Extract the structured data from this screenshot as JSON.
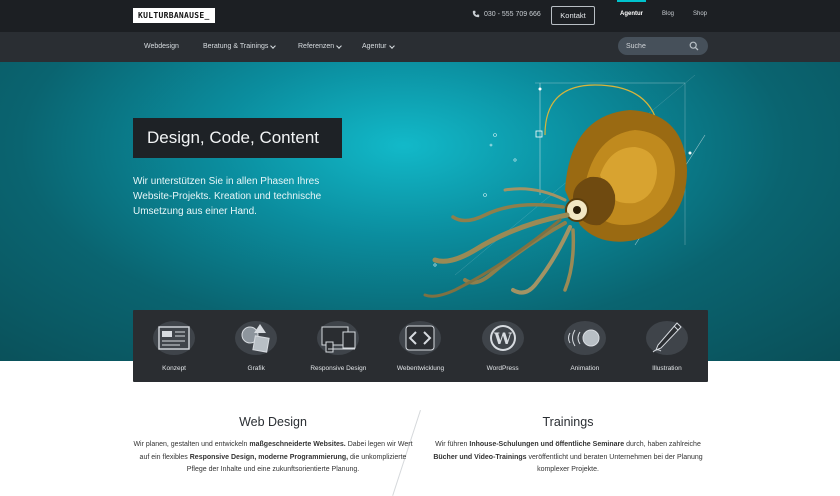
{
  "header": {
    "logo": "KULTURBANAUSE_",
    "phone": "030 - 555 709 666",
    "contact_button": "Kontakt",
    "top_links": [
      "Agentur",
      "Blog",
      "Shop"
    ]
  },
  "nav": {
    "items": [
      {
        "label": "Webdesign",
        "dropdown": false
      },
      {
        "label": "Beratung & Trainings",
        "dropdown": true
      },
      {
        "label": "Referenzen",
        "dropdown": true
      },
      {
        "label": "Agentur",
        "dropdown": true
      }
    ],
    "search_placeholder": "Suche"
  },
  "hero": {
    "title": "Design, Code, Content",
    "text": "Wir unterstützen Sie in allen Phasen Ihres Website-Projekts. Kreation und technische Umsetzung aus einer Hand."
  },
  "services": [
    {
      "label": "Konzept",
      "icon": "concept-icon"
    },
    {
      "label": "Grafik",
      "icon": "graphic-icon"
    },
    {
      "label": "Responsive Design",
      "icon": "responsive-icon"
    },
    {
      "label": "Webentwicklung",
      "icon": "code-icon"
    },
    {
      "label": "WordPress",
      "icon": "wordpress-icon"
    },
    {
      "label": "Animation",
      "icon": "animation-icon"
    },
    {
      "label": "Illustration",
      "icon": "illustration-icon"
    }
  ],
  "sections": {
    "web_design": {
      "title": "Web Design",
      "text_1": "Wir planen, gestalten und entwickeln ",
      "bold_1": "maßgeschneiderte Websites.",
      "text_2": " Dabei legen wir Wert auf ein flexibles ",
      "bold_2": "Responsive Design, moderne Programmierung,",
      "text_3": " die unkomplizierte Pflege der Inhalte und eine zukunftsorientierte Planung."
    },
    "trainings": {
      "title": "Trainings",
      "text_1": "Wir führen ",
      "bold_1": "Inhouse-Schulungen und öffentliche Seminare",
      "text_2": " durch, haben zahlreiche ",
      "bold_2": "Bücher und Video-Trainings",
      "text_3": " veröffentlicht und beraten Unternehmen bei der Planung komplexer Projekte."
    }
  },
  "colors": {
    "accent": "#00c2cc",
    "topbar": "#1c1f23",
    "navbar": "#2a2e33",
    "hero_teal": "#0b8d9e"
  }
}
